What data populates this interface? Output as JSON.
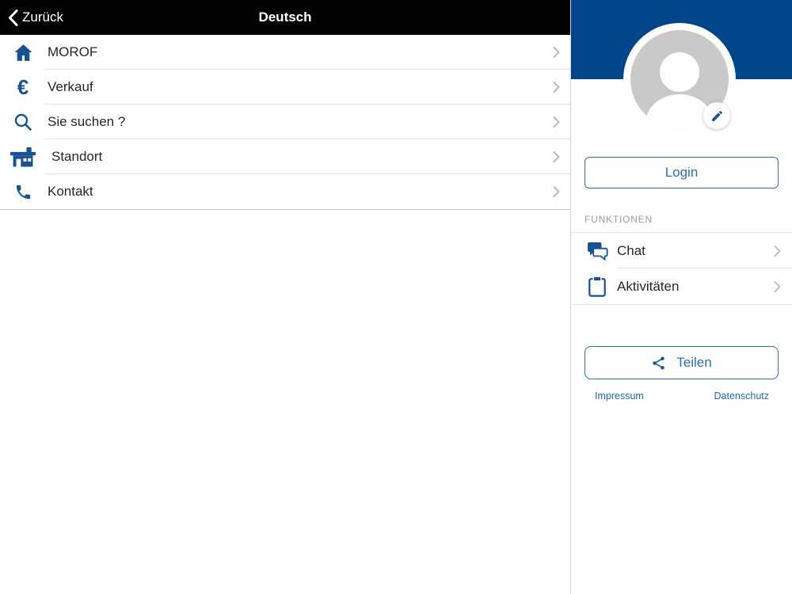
{
  "header": {
    "back_label": "Zurück",
    "title": "Deutsch"
  },
  "menu": {
    "items": [
      {
        "label": "MOROF",
        "icon": "home-icon"
      },
      {
        "label": "Verkauf",
        "icon": "euro-icon"
      },
      {
        "label": "Sie suchen ?",
        "icon": "search-icon"
      },
      {
        "label": "Standort",
        "icon": "store-icon"
      },
      {
        "label": "Kontakt",
        "icon": "phone-icon"
      }
    ]
  },
  "profile": {
    "login_label": "Login",
    "section_label": "FUNKTIONEN",
    "items": [
      {
        "label": "Chat",
        "icon": "chat-icon"
      },
      {
        "label": "Aktivitäten",
        "icon": "clipboard-icon"
      }
    ],
    "share_label": "Teilen",
    "links": [
      {
        "label": "Impressum"
      },
      {
        "label": "Datenschutz"
      }
    ]
  },
  "icons": {
    "euro_glyph": "€"
  },
  "colors": {
    "header_black": "#030303",
    "hero_blue": "#00458a",
    "icon_blue": "#1a5191",
    "action_blue": "#2e6db4",
    "link_blue": "#2166ad",
    "separator": "#e3e3e3",
    "avatar_gray": "#c9c9c9"
  }
}
